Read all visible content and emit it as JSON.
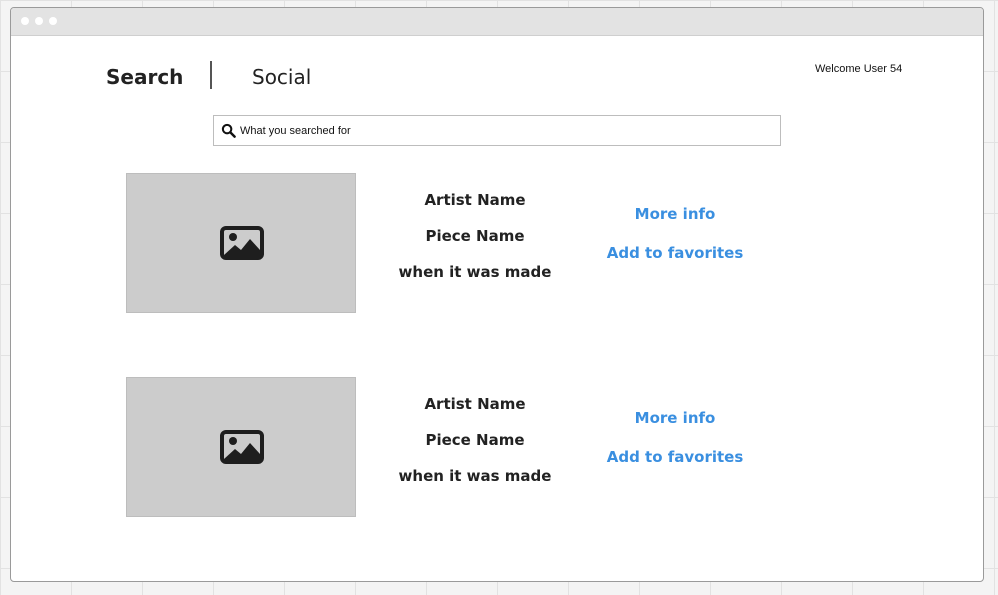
{
  "nav": {
    "search_tab": "Search",
    "social_tab": "Social"
  },
  "header": {
    "welcome": "Welcome User 54"
  },
  "search": {
    "value": "What you searched for"
  },
  "results": [
    {
      "artist": "Artist Name",
      "piece": "Piece Name",
      "date": "when it was made",
      "more_info": "More info",
      "add_favorites": "Add to favorites"
    },
    {
      "artist": "Artist Name",
      "piece": "Piece Name",
      "date": "when it was made",
      "more_info": "More info",
      "add_favorites": "Add to favorites"
    }
  ],
  "icons": {
    "search": "search-icon",
    "image": "image-placeholder-icon"
  },
  "colors": {
    "link": "#3a8fe0",
    "thumbnail": "#cccccc",
    "titlebar": "#e3e3e3"
  }
}
